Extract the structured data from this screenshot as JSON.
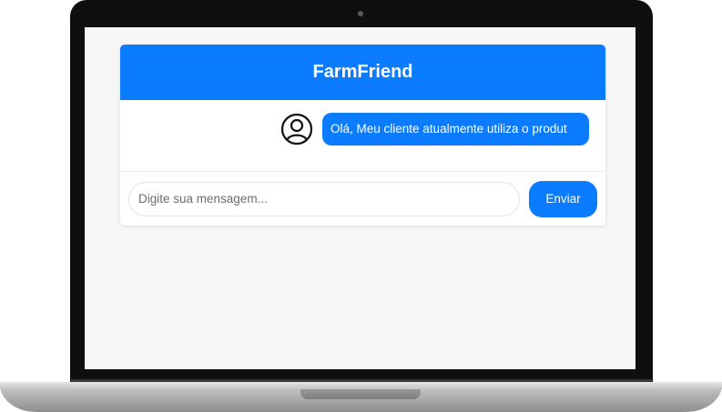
{
  "app": {
    "title": "FarmFriend"
  },
  "messages": [
    {
      "sender_icon": "user-circle-icon",
      "text": "Olá, Meu cliente atualmente utiliza o produt"
    }
  ],
  "composer": {
    "placeholder": "Digite sua mensagem...",
    "value": "",
    "send_label": "Enviar"
  },
  "colors": {
    "accent": "#0b7bff",
    "screen_bg": "#f7f7f7",
    "bezel": "#0f0f10"
  }
}
